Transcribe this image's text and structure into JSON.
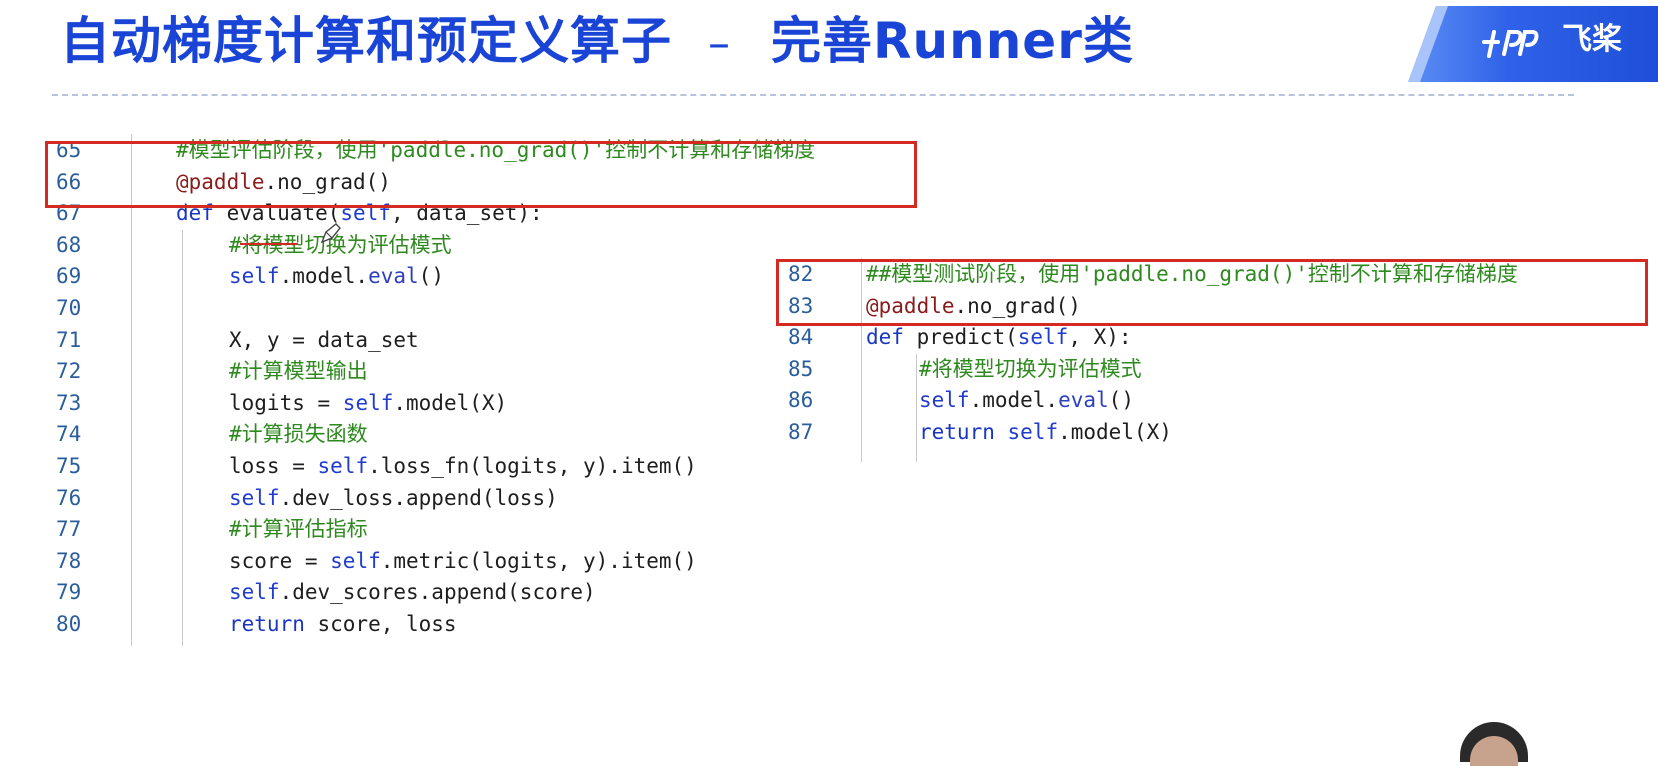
{
  "title": {
    "main": "自动梯度计算和预定义算子",
    "separator": "–",
    "sub": "完善Runner类"
  },
  "logo": {
    "text": "飞桨",
    "icon": "paddlepaddle-logo-icon",
    "accent": "#1f4fd8"
  },
  "colors": {
    "title": "#1a44d6",
    "comment": "#2e8a1e",
    "keyword": "#1936c2",
    "highlight_box": "#d42a22"
  },
  "left_code": {
    "lines": [
      {
        "num": "65",
        "parts": [
          {
            "t": "#模型评估阶段，使用'paddle.no_grad()'控制不计算和存储梯度",
            "c": "c-com"
          }
        ]
      },
      {
        "num": "66",
        "parts": [
          {
            "t": "@paddle",
            "c": "c-dec"
          },
          {
            "t": ".no_grad()",
            "c": ""
          }
        ]
      },
      {
        "num": "67",
        "parts": [
          {
            "t": "def",
            "c": "c-kw"
          },
          {
            "t": " evaluate(",
            "c": ""
          },
          {
            "t": "self",
            "c": "c-self"
          },
          {
            "t": ", data_set):",
            "c": ""
          }
        ]
      },
      {
        "num": "68",
        "parts": [
          {
            "t": "#将模型切换为评估模式",
            "c": "c-com"
          }
        ]
      },
      {
        "num": "69",
        "parts": [
          {
            "t": "self",
            "c": "c-self"
          },
          {
            "t": ".model.",
            "c": ""
          },
          {
            "t": "eval",
            "c": "c-fn"
          },
          {
            "t": "()",
            "c": ""
          }
        ]
      },
      {
        "num": "70",
        "parts": []
      },
      {
        "num": "71",
        "parts": [
          {
            "t": "X, y = data_set",
            "c": ""
          }
        ]
      },
      {
        "num": "72",
        "parts": [
          {
            "t": "#计算模型输出",
            "c": "c-com"
          }
        ]
      },
      {
        "num": "73",
        "parts": [
          {
            "t": "logits = ",
            "c": ""
          },
          {
            "t": "self",
            "c": "c-self"
          },
          {
            "t": ".model(X)",
            "c": ""
          }
        ]
      },
      {
        "num": "74",
        "parts": [
          {
            "t": "#计算损失函数",
            "c": "c-com"
          }
        ]
      },
      {
        "num": "75",
        "parts": [
          {
            "t": "loss = ",
            "c": ""
          },
          {
            "t": "self",
            "c": "c-self"
          },
          {
            "t": ".loss_fn(logits, y).item()",
            "c": ""
          }
        ]
      },
      {
        "num": "76",
        "parts": [
          {
            "t": "self",
            "c": "c-self"
          },
          {
            "t": ".dev_loss.append(loss)",
            "c": ""
          }
        ]
      },
      {
        "num": "77",
        "parts": [
          {
            "t": "#计算评估指标",
            "c": "c-com"
          }
        ]
      },
      {
        "num": "78",
        "parts": [
          {
            "t": "score = ",
            "c": ""
          },
          {
            "t": "self",
            "c": "c-self"
          },
          {
            "t": ".metric(logits, y).item()",
            "c": ""
          }
        ]
      },
      {
        "num": "79",
        "parts": [
          {
            "t": "self",
            "c": "c-self"
          },
          {
            "t": ".dev_scores.append(score)",
            "c": ""
          }
        ]
      },
      {
        "num": "80",
        "parts": [
          {
            "t": "return",
            "c": "c-kw"
          },
          {
            "t": " score, loss",
            "c": ""
          }
        ]
      }
    ]
  },
  "right_code": {
    "lines": [
      {
        "num": "82",
        "parts": [
          {
            "t": "##模型测试阶段，使用'paddle.no_grad()'控制不计算和存储梯度",
            "c": "c-com"
          }
        ]
      },
      {
        "num": "83",
        "parts": [
          {
            "t": "@paddle",
            "c": "c-dec"
          },
          {
            "t": ".no_grad()",
            "c": ""
          }
        ]
      },
      {
        "num": "84",
        "parts": [
          {
            "t": "def",
            "c": "c-kw"
          },
          {
            "t": " predict(",
            "c": ""
          },
          {
            "t": "self",
            "c": "c-self"
          },
          {
            "t": ", X):",
            "c": ""
          }
        ]
      },
      {
        "num": "85",
        "parts": [
          {
            "t": "#将模型切换为评估模式",
            "c": "c-com"
          }
        ]
      },
      {
        "num": "86",
        "parts": [
          {
            "t": "self",
            "c": "c-self"
          },
          {
            "t": ".model.",
            "c": ""
          },
          {
            "t": "eval",
            "c": "c-fn"
          },
          {
            "t": "()",
            "c": ""
          }
        ]
      },
      {
        "num": "87",
        "parts": [
          {
            "t": "return",
            "c": "c-kw"
          },
          {
            "t": " ",
            "c": ""
          },
          {
            "t": "self",
            "c": "c-self"
          },
          {
            "t": ".model(X)",
            "c": ""
          }
        ]
      }
    ]
  }
}
